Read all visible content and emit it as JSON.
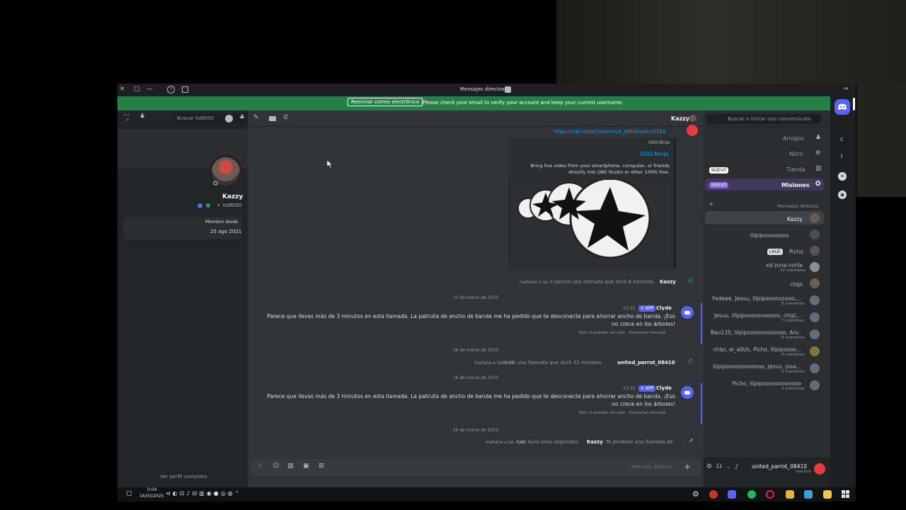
{
  "window": {
    "title": "Mensajes directos",
    "controls": {
      "close": "✕",
      "maximize": "□",
      "minimize": "—"
    }
  },
  "banner": {
    "text": "Please check your email to verify your account and keep your current username.",
    "button": "Reenviar correo electrónico"
  },
  "sidebar": {
    "search_placeholder": "Buscar o iniciar una conversación",
    "nav": [
      {
        "label": "Amigos",
        "icon": "friends-icon"
      },
      {
        "label": "Nitro",
        "icon": "nitro-icon"
      },
      {
        "label": "Tienda",
        "icon": "shop-icon",
        "badge": "NUEVO"
      },
      {
        "label": "Misiones",
        "icon": "quests-icon",
        "badge": "NUEVO"
      }
    ],
    "dm_header": "Mensajes directos",
    "dm_add": "+",
    "dms": [
      {
        "name": "Kazzy",
        "sub": ""
      },
      {
        "name": "lilpipoooooooo",
        "sub": ""
      },
      {
        "name": "Picho",
        "sub": "",
        "badge": "LAUE"
      },
      {
        "name": "xd zona norte",
        "sub": "10 miembros"
      },
      {
        "name": "chipi",
        "sub": ""
      },
      {
        "name": "Fedeee, Jesuu, lilpipooooooooo,...",
        "sub": "8 miembros"
      },
      {
        "name": "Jesuu, lilpipooooooooooo, chipi...",
        "sub": "7 miembros"
      },
      {
        "name": "Bau135, lilpipoooooooooooo, Aro...",
        "sub": "6 miembros"
      },
      {
        "name": "chipi, el_a0Us, Picho, lilpipoooo...",
        "sub": "6 miembros"
      },
      {
        "name": "lilpipoooooooooooo, Jesuu, josa...",
        "sub": "5 miembros"
      },
      {
        "name": "Picho, lilpipoooooooooooo",
        "sub": "3 miembros"
      }
    ],
    "user": {
      "name": "united_parrot_08410",
      "status": "Inactivo"
    }
  },
  "chat": {
    "header_name": "Kazzy",
    "search_placeholder": "Buscar tiz8030",
    "link": "https://vdo.ninja/?room=LA_AFF&hash=2154",
    "embed": {
      "site": "VDO.Ninja",
      "title": "VDO.Ninja",
      "description": "Bring live video from your smartphone, computer, or friends directly into OBS Studio or other 100% free."
    },
    "messages": [
      {
        "type": "call",
        "author": "Kazzy",
        "text": "inició una llamada que duró 6 minutos.",
        "time": "mañana a las 3:32"
      },
      {
        "type": "date",
        "text": "15 de marzo de 2025"
      },
      {
        "type": "bot",
        "author": "Clyde",
        "tag": "✔ APP",
        "time": "23:31",
        "text": "Parece que llevas más de 3 minutos en esta llamada. La patrulla de ancho de banda me ha pedido que te desconecte para ahorrar ancho de banda. ¡Eso no crece en los árboles!",
        "note": "Solo tú puedes ver esto · Descartar mensaje"
      },
      {
        "type": "date",
        "text": "16 de marzo de 2025"
      },
      {
        "type": "call",
        "author": "united_parrot_08410",
        "text": "inició una llamada que duró 32 minutos.",
        "time": "mañana a las 3:41"
      },
      {
        "type": "date",
        "text": "16 de marzo de 2025"
      },
      {
        "type": "bot",
        "author": "Clyde",
        "tag": "✔ APP",
        "time": "23:31",
        "text": "Parece que llevas más de 3 minutos en esta llamada. La patrulla de ancho de banda me ha pedido que te desconecte para ahorrar ancho de banda. ¡Eso no crece en los árboles!",
        "note": "Solo tú puedes ver esto · Descartar mensaje"
      },
      {
        "type": "date",
        "text": "16 de marzo de 2025"
      },
      {
        "type": "missed",
        "text_before": "Te perdiste una llamada de",
        "author": "Kazzy",
        "text_after": "que duró unos segundos.",
        "time": "mañana a las 4:40"
      }
    ],
    "input_placeholder": "Mensaje @Kazzy"
  },
  "profile": {
    "name": "Kazzy",
    "tag": "tiz8030",
    "member_since_label": "Miembro desde",
    "member_since": "25 ago 2021",
    "view_full": "Ver perfil completo"
  },
  "taskbar": {
    "time": "0:04",
    "date": "16/03/2025"
  },
  "colors": {
    "blurple": "#5865f2",
    "green_banner": "#248046",
    "bg": "#313338",
    "sidebar": "#2b2d31"
  }
}
